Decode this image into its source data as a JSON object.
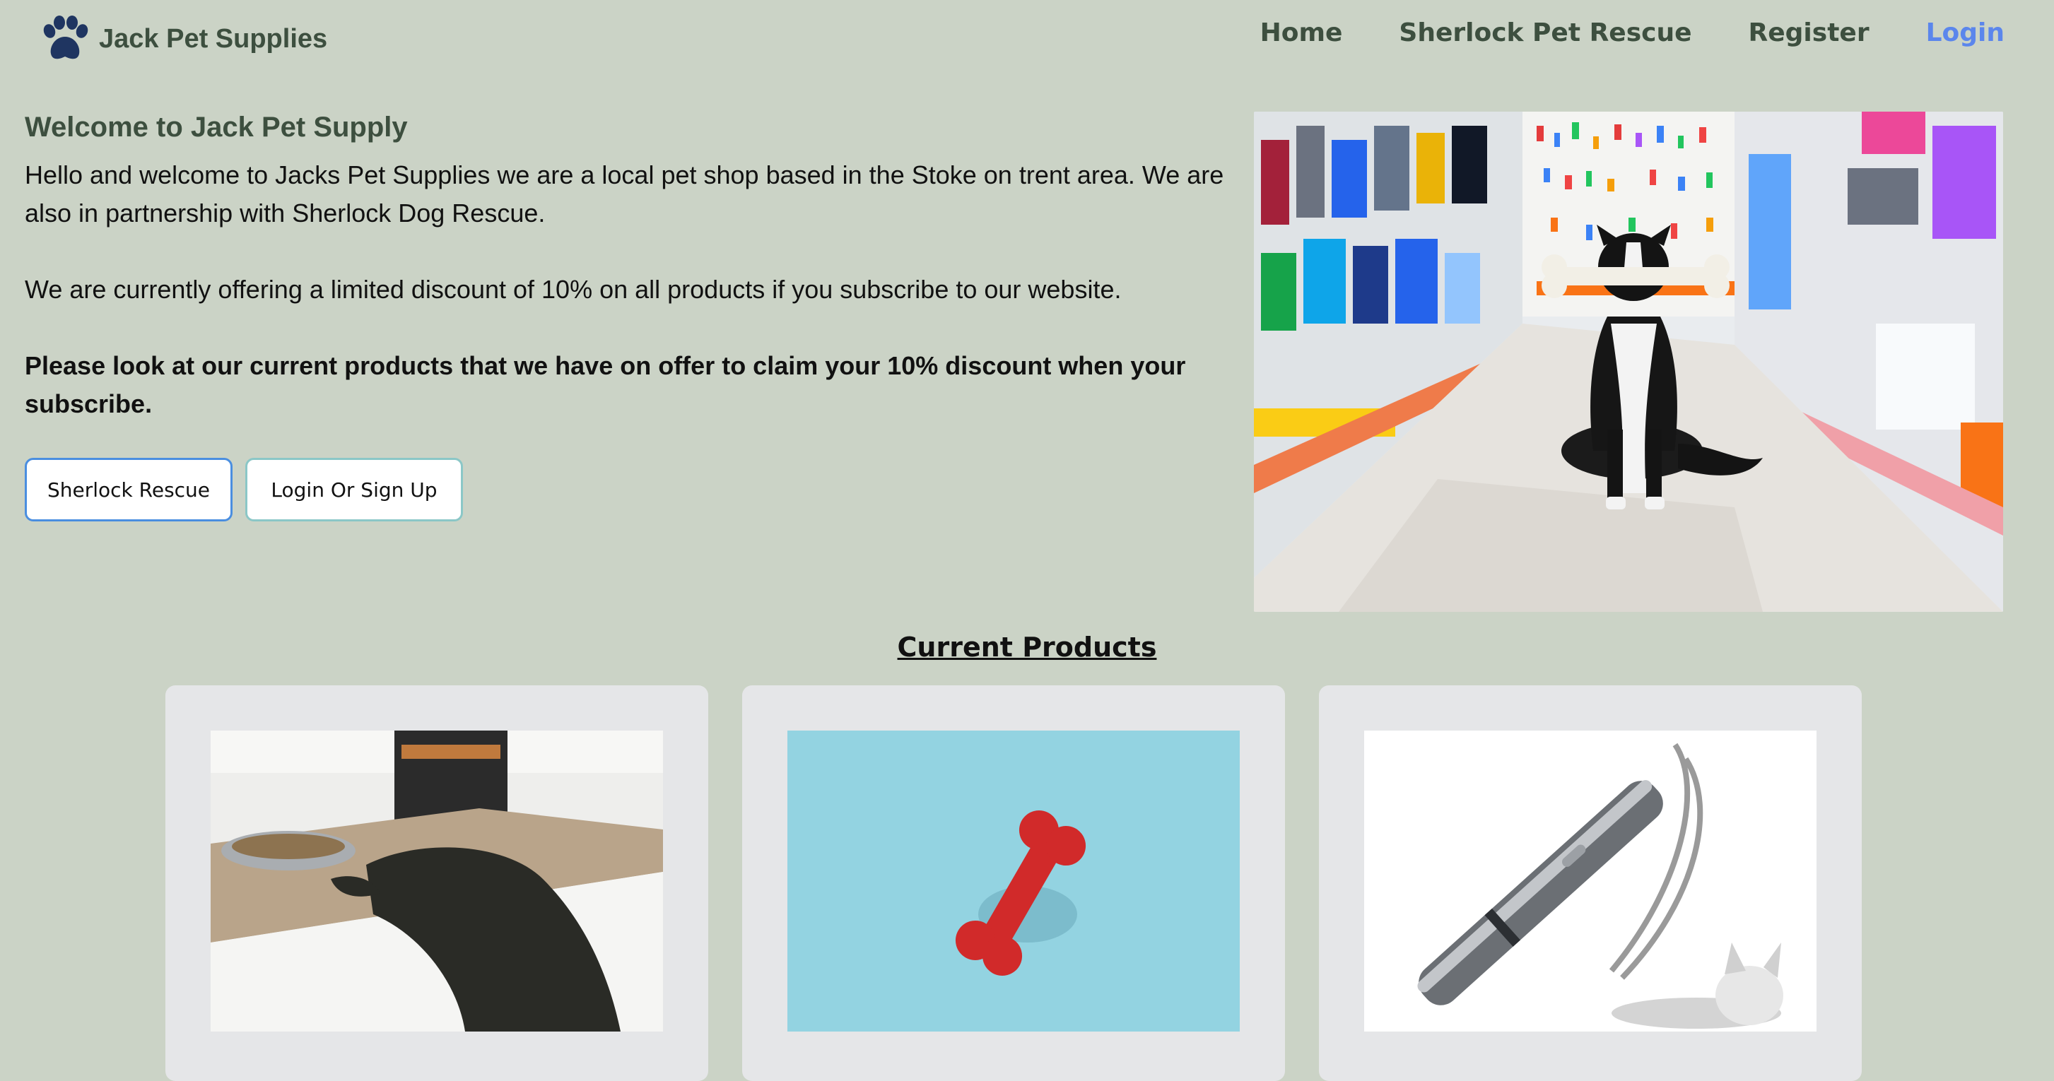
{
  "brand": {
    "name": "Jack Pet Supplies",
    "logo_icon": "paw-icon",
    "logo_color": "#1f3561"
  },
  "nav": {
    "items": [
      {
        "label": "Home",
        "active": false
      },
      {
        "label": "Sherlock Pet Rescue",
        "active": false
      },
      {
        "label": "Register",
        "active": false
      },
      {
        "label": "Login",
        "active": true
      }
    ],
    "active_color": "#5b86ec"
  },
  "hero": {
    "title": "Welcome to Jack Pet Supply",
    "paragraph1": "Hello and welcome to Jacks Pet Supplies we are a local pet shop based in the Stoke on trent area. We are also in partnership with Sherlock Dog Rescue.",
    "paragraph2": "We are currently offering a limited discount of 10% on all products if you subscribe to our website.",
    "paragraph3": "Please look at our current products that we have on offer to claim your 10% discount when your subscribe.",
    "buttons": {
      "rescue": "Sherlock Rescue",
      "login": "Login Or Sign Up"
    }
  },
  "products": {
    "title": "Current Products"
  },
  "colors": {
    "background": "#cbd3c6",
    "heading": "#3d4f3f",
    "card": "#e5e6e8"
  }
}
